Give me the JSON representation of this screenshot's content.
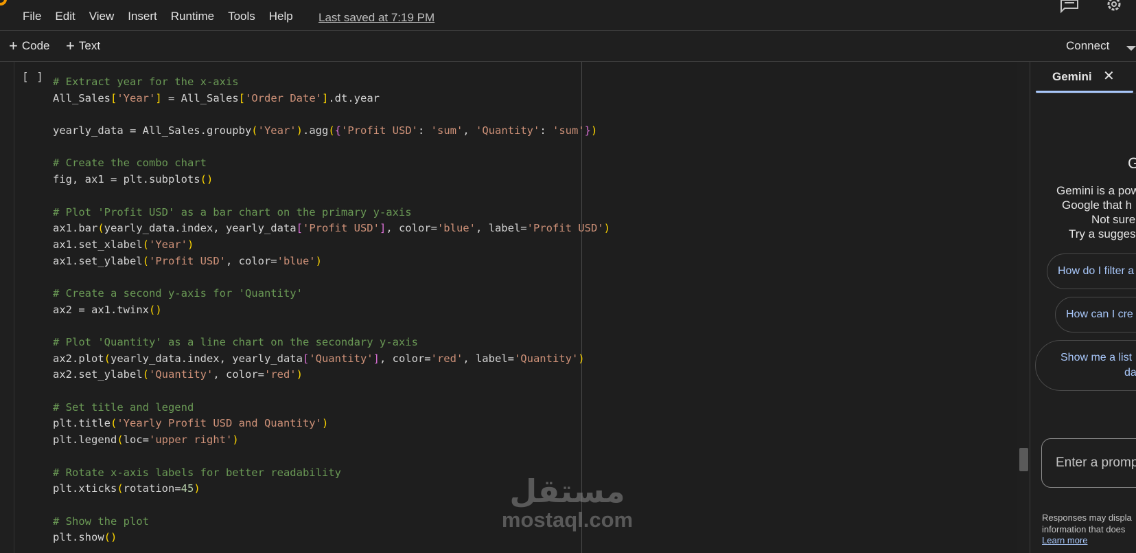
{
  "menubar": {
    "items": [
      "File",
      "Edit",
      "View",
      "Insert",
      "Runtime",
      "Tools",
      "Help"
    ],
    "last_saved": "Last saved at 7:19 PM"
  },
  "toolbar": {
    "code_label": "Code",
    "text_label": "Text",
    "connect_label": "Connect"
  },
  "cell": {
    "run_indicator": "[ ]",
    "code_lines": [
      [
        [
          "c",
          "# Extract year for the x-axis"
        ]
      ],
      [
        [
          "p",
          "All_Sales"
        ],
        [
          "b1",
          "["
        ],
        [
          "s",
          "'Year'"
        ],
        [
          "b1",
          "]"
        ],
        [
          "p",
          " = All_Sales"
        ],
        [
          "b1",
          "["
        ],
        [
          "s",
          "'Order Date'"
        ],
        [
          "b1",
          "]"
        ],
        [
          "p",
          ".dt.year"
        ]
      ],
      [],
      [
        [
          "p",
          "yearly_data = All_Sales.groupby"
        ],
        [
          "b1",
          "("
        ],
        [
          "s",
          "'Year'"
        ],
        [
          "b1",
          ")"
        ],
        [
          "p",
          ".agg"
        ],
        [
          "b1",
          "("
        ],
        [
          "b2",
          "{"
        ],
        [
          "s",
          "'Profit USD'"
        ],
        [
          "p",
          ": "
        ],
        [
          "s",
          "'sum'"
        ],
        [
          "p",
          ", "
        ],
        [
          "s",
          "'Quantity'"
        ],
        [
          "p",
          ": "
        ],
        [
          "s",
          "'sum'"
        ],
        [
          "b2",
          "}"
        ],
        [
          "b1",
          ")"
        ]
      ],
      [],
      [
        [
          "c",
          "# Create the combo chart"
        ]
      ],
      [
        [
          "p",
          "fig, ax1 = plt.subplots"
        ],
        [
          "b1",
          "()"
        ]
      ],
      [],
      [
        [
          "c",
          "# Plot 'Profit USD' as a bar chart on the primary y-axis"
        ]
      ],
      [
        [
          "p",
          "ax1.bar"
        ],
        [
          "b1",
          "("
        ],
        [
          "p",
          "yearly_data.index, yearly_data"
        ],
        [
          "b2",
          "["
        ],
        [
          "s",
          "'Profit USD'"
        ],
        [
          "b2",
          "]"
        ],
        [
          "p",
          ", color="
        ],
        [
          "s",
          "'blue'"
        ],
        [
          "p",
          ", label="
        ],
        [
          "s",
          "'Profit USD'"
        ],
        [
          "b1",
          ")"
        ]
      ],
      [
        [
          "p",
          "ax1.set_xlabel"
        ],
        [
          "b1",
          "("
        ],
        [
          "s",
          "'Year'"
        ],
        [
          "b1",
          ")"
        ]
      ],
      [
        [
          "p",
          "ax1.set_ylabel"
        ],
        [
          "b1",
          "("
        ],
        [
          "s",
          "'Profit USD'"
        ],
        [
          "p",
          ", color="
        ],
        [
          "s",
          "'blue'"
        ],
        [
          "b1",
          ")"
        ]
      ],
      [],
      [
        [
          "c",
          "# Create a second y-axis for 'Quantity'"
        ]
      ],
      [
        [
          "p",
          "ax2 = ax1.twinx"
        ],
        [
          "b1",
          "()"
        ]
      ],
      [],
      [
        [
          "c",
          "# Plot 'Quantity' as a line chart on the secondary y-axis"
        ]
      ],
      [
        [
          "p",
          "ax2.plot"
        ],
        [
          "b1",
          "("
        ],
        [
          "p",
          "yearly_data.index, yearly_data"
        ],
        [
          "b2",
          "["
        ],
        [
          "s",
          "'Quantity'"
        ],
        [
          "b2",
          "]"
        ],
        [
          "p",
          ", color="
        ],
        [
          "s",
          "'red'"
        ],
        [
          "p",
          ", label="
        ],
        [
          "s",
          "'Quantity'"
        ],
        [
          "b1",
          ")"
        ]
      ],
      [
        [
          "p",
          "ax2.set_ylabel"
        ],
        [
          "b1",
          "("
        ],
        [
          "s",
          "'Quantity'"
        ],
        [
          "p",
          ", color="
        ],
        [
          "s",
          "'red'"
        ],
        [
          "b1",
          ")"
        ]
      ],
      [],
      [
        [
          "c",
          "# Set title and legend"
        ]
      ],
      [
        [
          "p",
          "plt.title"
        ],
        [
          "b1",
          "("
        ],
        [
          "s",
          "'Yearly Profit USD and Quantity'"
        ],
        [
          "b1",
          ")"
        ]
      ],
      [
        [
          "p",
          "plt.legend"
        ],
        [
          "b1",
          "("
        ],
        [
          "p",
          "loc="
        ],
        [
          "s",
          "'upper right'"
        ],
        [
          "b1",
          ")"
        ]
      ],
      [],
      [
        [
          "c",
          "# Rotate x-axis labels for better readability"
        ]
      ],
      [
        [
          "p",
          "plt.xticks"
        ],
        [
          "b1",
          "("
        ],
        [
          "p",
          "rotation="
        ],
        [
          "n",
          "45"
        ],
        [
          "b1",
          ")"
        ]
      ],
      [],
      [
        [
          "c",
          "# Show the plot"
        ]
      ],
      [
        [
          "p",
          "plt.show"
        ],
        [
          "b1",
          "()"
        ]
      ]
    ]
  },
  "watermark": {
    "arabic": "مستقل",
    "latin": "mostaql.com"
  },
  "gemini": {
    "tab_label": "Gemini",
    "heading": "G",
    "desc_lines": [
      "Gemini is a pow",
      "Google that h",
      "Not sure",
      "Try a sugges"
    ],
    "chips": [
      "How do I filter a",
      "How can I cre"
    ],
    "chip_tall_lines": [
      "Show me a list",
      "da"
    ],
    "prompt_placeholder": "Enter a promp",
    "disclaimer_lines": [
      "Responses may displa",
      "information that does"
    ],
    "learn_more": "Learn more"
  },
  "colors": {
    "background": "#1f1f1f",
    "comment": "#6a9955",
    "string": "#ce9178",
    "bracket_primary": "#ffd700",
    "bracket_secondary": "#da70d6",
    "link": "#a8c7fa"
  }
}
